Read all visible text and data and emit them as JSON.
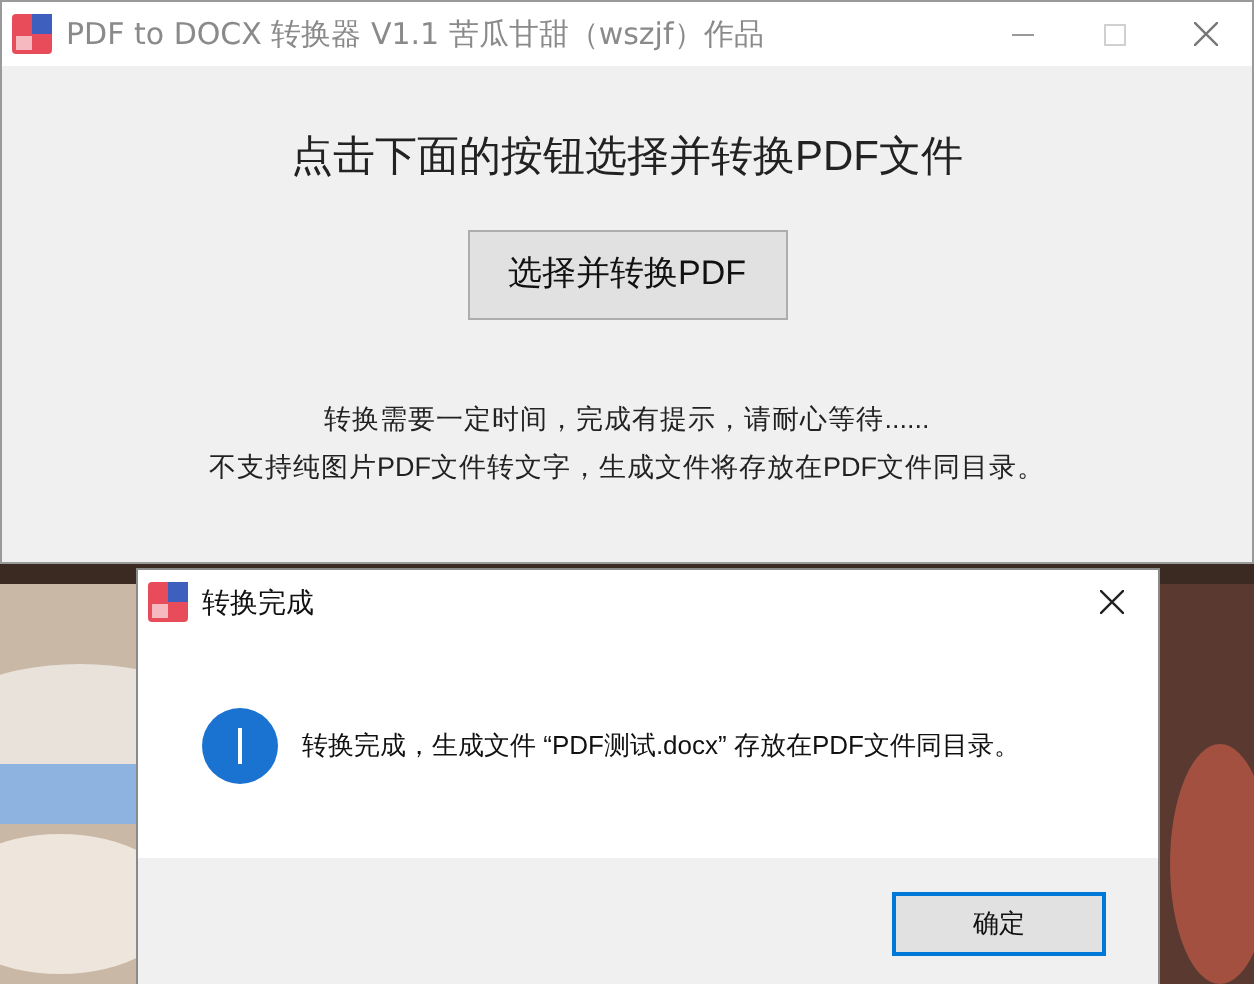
{
  "window": {
    "title": "PDF to DOCX 转换器 V1.1 苦瓜甘甜（wszjf）作品",
    "heading": "点击下面的按钮选择并转换PDF文件",
    "button": "选择并转换PDF",
    "notes": [
      "转换需要一定时间，完成有提示，请耐心等待......",
      "不支持纯图片PDF文件转文字，生成文件将存放在PDF文件同目录。"
    ],
    "maximize_disabled": true
  },
  "dialog": {
    "title": "转换完成",
    "message": "转换完成，生成文件 “PDF测试.docx” 存放在PDF文件同目录。",
    "button": "确定"
  }
}
